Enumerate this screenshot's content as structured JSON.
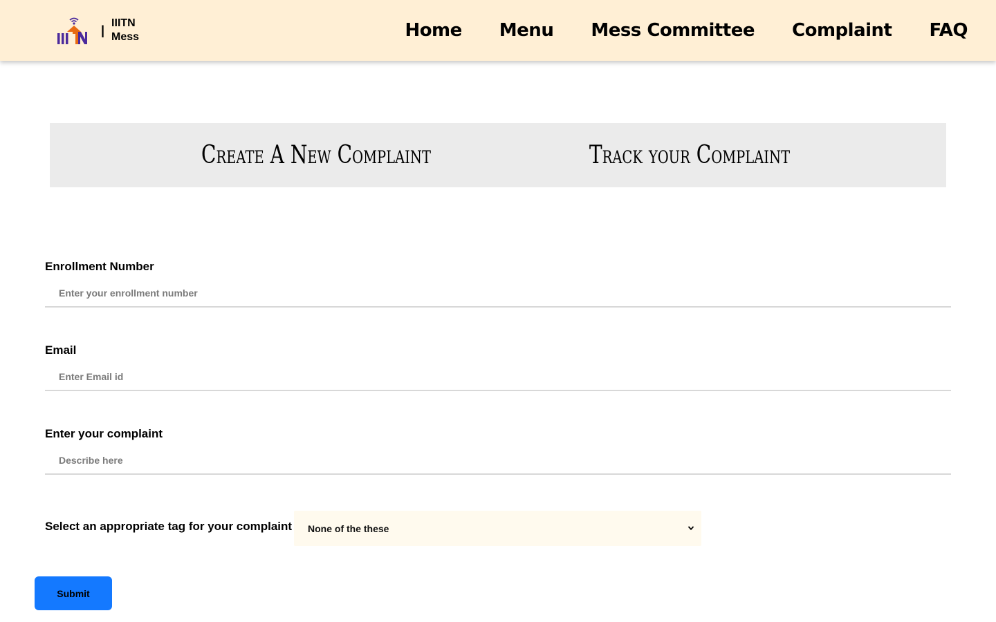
{
  "brand": {
    "separator": "|",
    "line1": "IIITN",
    "line2": "Mess",
    "logo_icon": "iiitn-logo-icon",
    "colors": {
      "purple": "#4b2a9c",
      "orange": "#e86a12"
    }
  },
  "nav": {
    "items": [
      {
        "label": "Home"
      },
      {
        "label": "Menu"
      },
      {
        "label": "Mess Committee"
      },
      {
        "label": "Complaint"
      },
      {
        "label": "FAQ"
      }
    ]
  },
  "tabs": {
    "create": "Create A New Complaint",
    "track": "Track your Complaint"
  },
  "form": {
    "enrollment": {
      "label": "Enrollment Number",
      "placeholder": "Enter your enrollment number"
    },
    "email": {
      "label": "Email",
      "placeholder": "Enter Email id"
    },
    "complaint": {
      "label": "Enter your complaint",
      "placeholder": "Describe here"
    },
    "tag": {
      "label": "Select an appropriate tag for your complaint",
      "selected": "None of the these",
      "icon": "chevron-down-icon"
    },
    "submit_label": "Submit"
  },
  "colors": {
    "navbar_bg": "#ffefd5",
    "tabbar_bg": "#ebebeb",
    "select_bg": "#fffaee",
    "submit_bg": "#1479ff"
  }
}
